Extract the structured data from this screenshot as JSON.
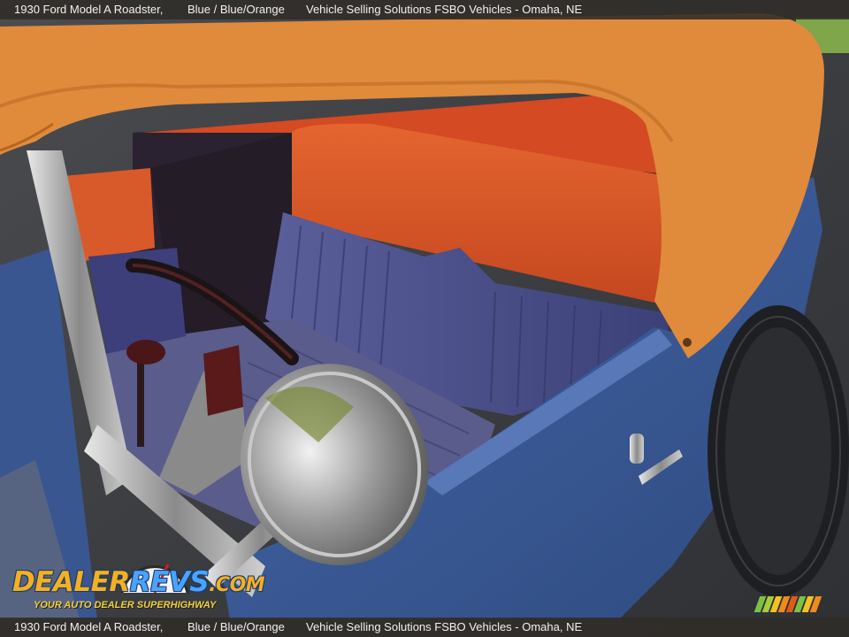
{
  "header": {
    "car": "1930 Ford Model A Roadster,",
    "color": "Blue / Blue/Orange",
    "dealer": "Vehicle Selling Solutions FSBO Vehicles - Omaha, NE"
  },
  "footer": {
    "car": "1930 Ford Model A Roadster,",
    "color": "Blue / Blue/Orange",
    "dealer": "Vehicle Selling Solutions FSBO Vehicles - Omaha, NE"
  },
  "watermark": {
    "brand_part1": "DEALER",
    "brand_part2": "REVS",
    "brand_part3": ".COM",
    "tagline": "YOUR AUTO DEALER SUPERHIGHWAY"
  },
  "colors": {
    "top_orange": "#e08a3c",
    "seat_orange": "#d85a2a",
    "seat_blue": "#4a4f86",
    "body_blue": "#3b5a96",
    "pavement": "#3a3c40"
  },
  "stripe_colors": [
    "#7cc242",
    "#a8cc3a",
    "#f2c21f",
    "#f08a1c",
    "#e05a1c",
    "#7cc242",
    "#f2c21f",
    "#f08a1c"
  ]
}
